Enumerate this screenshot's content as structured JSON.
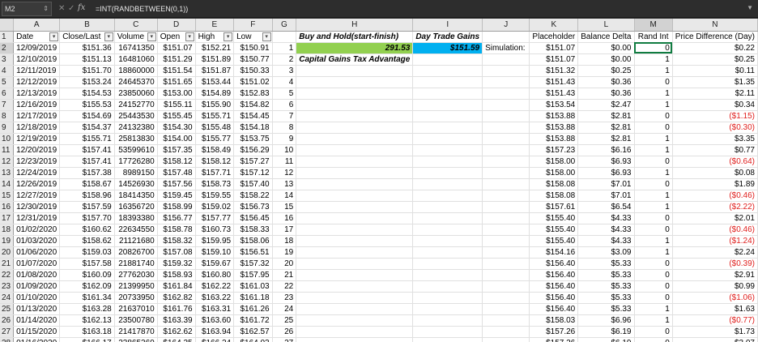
{
  "formula_bar": {
    "cell_ref": "M2",
    "formula": "=INT(RANDBETWEEN(0,1))",
    "fx_label": "fx"
  },
  "columns": [
    "A",
    "B",
    "C",
    "D",
    "E",
    "F",
    "G",
    "H",
    "I",
    "J",
    "K",
    "L",
    "M",
    "N"
  ],
  "selected_column": "M",
  "selected_row": 2,
  "header_row": {
    "A": "Date",
    "B": "Close/Last",
    "C": "Volume",
    "D": "Open",
    "E": "High",
    "F": "Low",
    "H": "Buy and Hold(start-finish)",
    "I": "Day Trade Gains",
    "K": "Placeholder",
    "L": "Balance Delta",
    "M": "Rand Int",
    "N": "Price Difference (Day)"
  },
  "h_values": {
    "row2": "291.53",
    "row3": "Capital Gains Tax Advantage"
  },
  "i_values": {
    "row2": "$151.59"
  },
  "j_values": {
    "row2": "Simulation:"
  },
  "rows": [
    {
      "n": 2,
      "A": "12/09/2019",
      "B": "$151.36",
      "C": "16741350",
      "D": "$151.07",
      "E": "$152.21",
      "F": "$150.91",
      "G": "1",
      "K": "$151.07",
      "L": "$0.00",
      "M": "0",
      "N": "$0.22",
      "neg": false
    },
    {
      "n": 3,
      "A": "12/10/2019",
      "B": "$151.13",
      "C": "16481060",
      "D": "$151.29",
      "E": "$151.89",
      "F": "$150.77",
      "G": "2",
      "K": "$151.07",
      "L": "$0.00",
      "M": "1",
      "N": "$0.25",
      "neg": false
    },
    {
      "n": 4,
      "A": "12/11/2019",
      "B": "$151.70",
      "C": "18860000",
      "D": "$151.54",
      "E": "$151.87",
      "F": "$150.33",
      "G": "3",
      "K": "$151.32",
      "L": "$0.25",
      "M": "1",
      "N": "$0.11",
      "neg": false
    },
    {
      "n": 5,
      "A": "12/12/2019",
      "B": "$153.24",
      "C": "24645370",
      "D": "$151.65",
      "E": "$153.44",
      "F": "$151.02",
      "G": "4",
      "K": "$151.43",
      "L": "$0.36",
      "M": "0",
      "N": "$1.35",
      "neg": false
    },
    {
      "n": 6,
      "A": "12/13/2019",
      "B": "$154.53",
      "C": "23850060",
      "D": "$153.00",
      "E": "$154.89",
      "F": "$152.83",
      "G": "5",
      "K": "$151.43",
      "L": "$0.36",
      "M": "1",
      "N": "$2.11",
      "neg": false
    },
    {
      "n": 7,
      "A": "12/16/2019",
      "B": "$155.53",
      "C": "24152770",
      "D": "$155.11",
      "E": "$155.90",
      "F": "$154.82",
      "G": "6",
      "K": "$153.54",
      "L": "$2.47",
      "M": "1",
      "N": "$0.34",
      "neg": false
    },
    {
      "n": 8,
      "A": "12/17/2019",
      "B": "$154.69",
      "C": "25443530",
      "D": "$155.45",
      "E": "$155.71",
      "F": "$154.45",
      "G": "7",
      "K": "$153.88",
      "L": "$2.81",
      "M": "0",
      "N": "($1.15)",
      "neg": true
    },
    {
      "n": 9,
      "A": "12/18/2019",
      "B": "$154.37",
      "C": "24132380",
      "D": "$154.30",
      "E": "$155.48",
      "F": "$154.18",
      "G": "8",
      "K": "$153.88",
      "L": "$2.81",
      "M": "0",
      "N": "($0.30)",
      "neg": true
    },
    {
      "n": 10,
      "A": "12/19/2019",
      "B": "$155.71",
      "C": "25813830",
      "D": "$154.00",
      "E": "$155.77",
      "F": "$153.75",
      "G": "9",
      "K": "$153.88",
      "L": "$2.81",
      "M": "1",
      "N": "$3.35",
      "neg": false
    },
    {
      "n": 11,
      "A": "12/20/2019",
      "B": "$157.41",
      "C": "53599610",
      "D": "$157.35",
      "E": "$158.49",
      "F": "$156.29",
      "G": "10",
      "K": "$157.23",
      "L": "$6.16",
      "M": "1",
      "N": "$0.77",
      "neg": false
    },
    {
      "n": 12,
      "A": "12/23/2019",
      "B": "$157.41",
      "C": "17726280",
      "D": "$158.12",
      "E": "$158.12",
      "F": "$157.27",
      "G": "11",
      "K": "$158.00",
      "L": "$6.93",
      "M": "0",
      "N": "($0.64)",
      "neg": true
    },
    {
      "n": 13,
      "A": "12/24/2019",
      "B": "$157.38",
      "C": "8989150",
      "D": "$157.48",
      "E": "$157.71",
      "F": "$157.12",
      "G": "12",
      "K": "$158.00",
      "L": "$6.93",
      "M": "1",
      "N": "$0.08",
      "neg": false
    },
    {
      "n": 14,
      "A": "12/26/2019",
      "B": "$158.67",
      "C": "14526930",
      "D": "$157.56",
      "E": "$158.73",
      "F": "$157.40",
      "G": "13",
      "K": "$158.08",
      "L": "$7.01",
      "M": "0",
      "N": "$1.89",
      "neg": false
    },
    {
      "n": 15,
      "A": "12/27/2019",
      "B": "$158.96",
      "C": "18414350",
      "D": "$159.45",
      "E": "$159.55",
      "F": "$158.22",
      "G": "14",
      "K": "$158.08",
      "L": "$7.01",
      "M": "1",
      "N": "($0.46)",
      "neg": true
    },
    {
      "n": 16,
      "A": "12/30/2019",
      "B": "$157.59",
      "C": "16356720",
      "D": "$158.99",
      "E": "$159.02",
      "F": "$156.73",
      "G": "15",
      "K": "$157.61",
      "L": "$6.54",
      "M": "1",
      "N": "($2.22)",
      "neg": true
    },
    {
      "n": 17,
      "A": "12/31/2019",
      "B": "$157.70",
      "C": "18393380",
      "D": "$156.77",
      "E": "$157.77",
      "F": "$156.45",
      "G": "16",
      "K": "$155.40",
      "L": "$4.33",
      "M": "0",
      "N": "$2.01",
      "neg": false
    },
    {
      "n": 18,
      "A": "01/02/2020",
      "B": "$160.62",
      "C": "22634550",
      "D": "$158.78",
      "E": "$160.73",
      "F": "$158.33",
      "G": "17",
      "K": "$155.40",
      "L": "$4.33",
      "M": "0",
      "N": "($0.46)",
      "neg": true
    },
    {
      "n": 19,
      "A": "01/03/2020",
      "B": "$158.62",
      "C": "21121680",
      "D": "$158.32",
      "E": "$159.95",
      "F": "$158.06",
      "G": "18",
      "K": "$155.40",
      "L": "$4.33",
      "M": "1",
      "N": "($1.24)",
      "neg": true
    },
    {
      "n": 20,
      "A": "01/06/2020",
      "B": "$159.03",
      "C": "20826700",
      "D": "$157.08",
      "E": "$159.10",
      "F": "$156.51",
      "G": "19",
      "K": "$154.16",
      "L": "$3.09",
      "M": "1",
      "N": "$2.24",
      "neg": false
    },
    {
      "n": 21,
      "A": "01/07/2020",
      "B": "$157.58",
      "C": "21881740",
      "D": "$159.32",
      "E": "$159.67",
      "F": "$157.32",
      "G": "20",
      "K": "$156.40",
      "L": "$5.33",
      "M": "0",
      "N": "($0.39)",
      "neg": true
    },
    {
      "n": 22,
      "A": "01/08/2020",
      "B": "$160.09",
      "C": "27762030",
      "D": "$158.93",
      "E": "$160.80",
      "F": "$157.95",
      "G": "21",
      "K": "$156.40",
      "L": "$5.33",
      "M": "0",
      "N": "$2.91",
      "neg": false
    },
    {
      "n": 23,
      "A": "01/09/2020",
      "B": "$162.09",
      "C": "21399950",
      "D": "$161.84",
      "E": "$162.22",
      "F": "$161.03",
      "G": "22",
      "K": "$156.40",
      "L": "$5.33",
      "M": "0",
      "N": "$0.99",
      "neg": false
    },
    {
      "n": 24,
      "A": "01/10/2020",
      "B": "$161.34",
      "C": "20733950",
      "D": "$162.82",
      "E": "$163.22",
      "F": "$161.18",
      "G": "23",
      "K": "$156.40",
      "L": "$5.33",
      "M": "0",
      "N": "($1.06)",
      "neg": true
    },
    {
      "n": 25,
      "A": "01/13/2020",
      "B": "$163.28",
      "C": "21637010",
      "D": "$161.76",
      "E": "$163.31",
      "F": "$161.26",
      "G": "24",
      "K": "$156.40",
      "L": "$5.33",
      "M": "1",
      "N": "$1.63",
      "neg": false
    },
    {
      "n": 26,
      "A": "01/14/2020",
      "B": "$162.13",
      "C": "23500780",
      "D": "$163.39",
      "E": "$163.60",
      "F": "$161.72",
      "G": "25",
      "K": "$158.03",
      "L": "$6.96",
      "M": "1",
      "N": "($0.77)",
      "neg": true
    },
    {
      "n": 27,
      "A": "01/15/2020",
      "B": "$163.18",
      "C": "21417870",
      "D": "$162.62",
      "E": "$163.94",
      "F": "$162.57",
      "G": "26",
      "K": "$157.26",
      "L": "$6.19",
      "M": "0",
      "N": "$1.73",
      "neg": false
    },
    {
      "n": 28,
      "A": "01/16/2020",
      "B": "$166.17",
      "C": "23865360",
      "D": "$164.35",
      "E": "$166.24",
      "F": "$164.03",
      "G": "27",
      "K": "$157.26",
      "L": "$6.19",
      "M": "0",
      "N": "$3.07",
      "neg": false
    }
  ]
}
